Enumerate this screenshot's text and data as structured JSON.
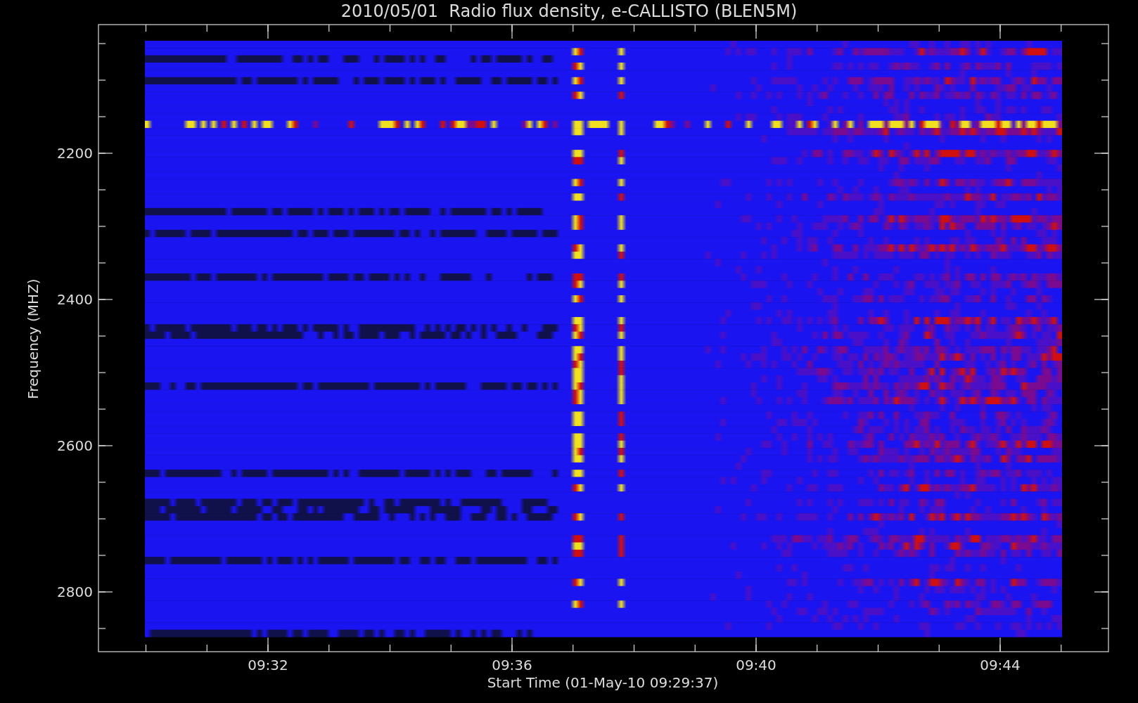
{
  "title": "2010/05/01  Radio flux density, e-CALLISTO (BLEN5M)",
  "y_axis": {
    "label": "Frequency (MHZ)",
    "ticks": [
      "2200",
      "2400",
      "2600",
      "2800"
    ]
  },
  "x_axis": {
    "label": "Start Time (01-May-10 09:29:37)",
    "ticks": [
      "09:32",
      "09:36",
      "09:40",
      "09:44"
    ]
  }
}
